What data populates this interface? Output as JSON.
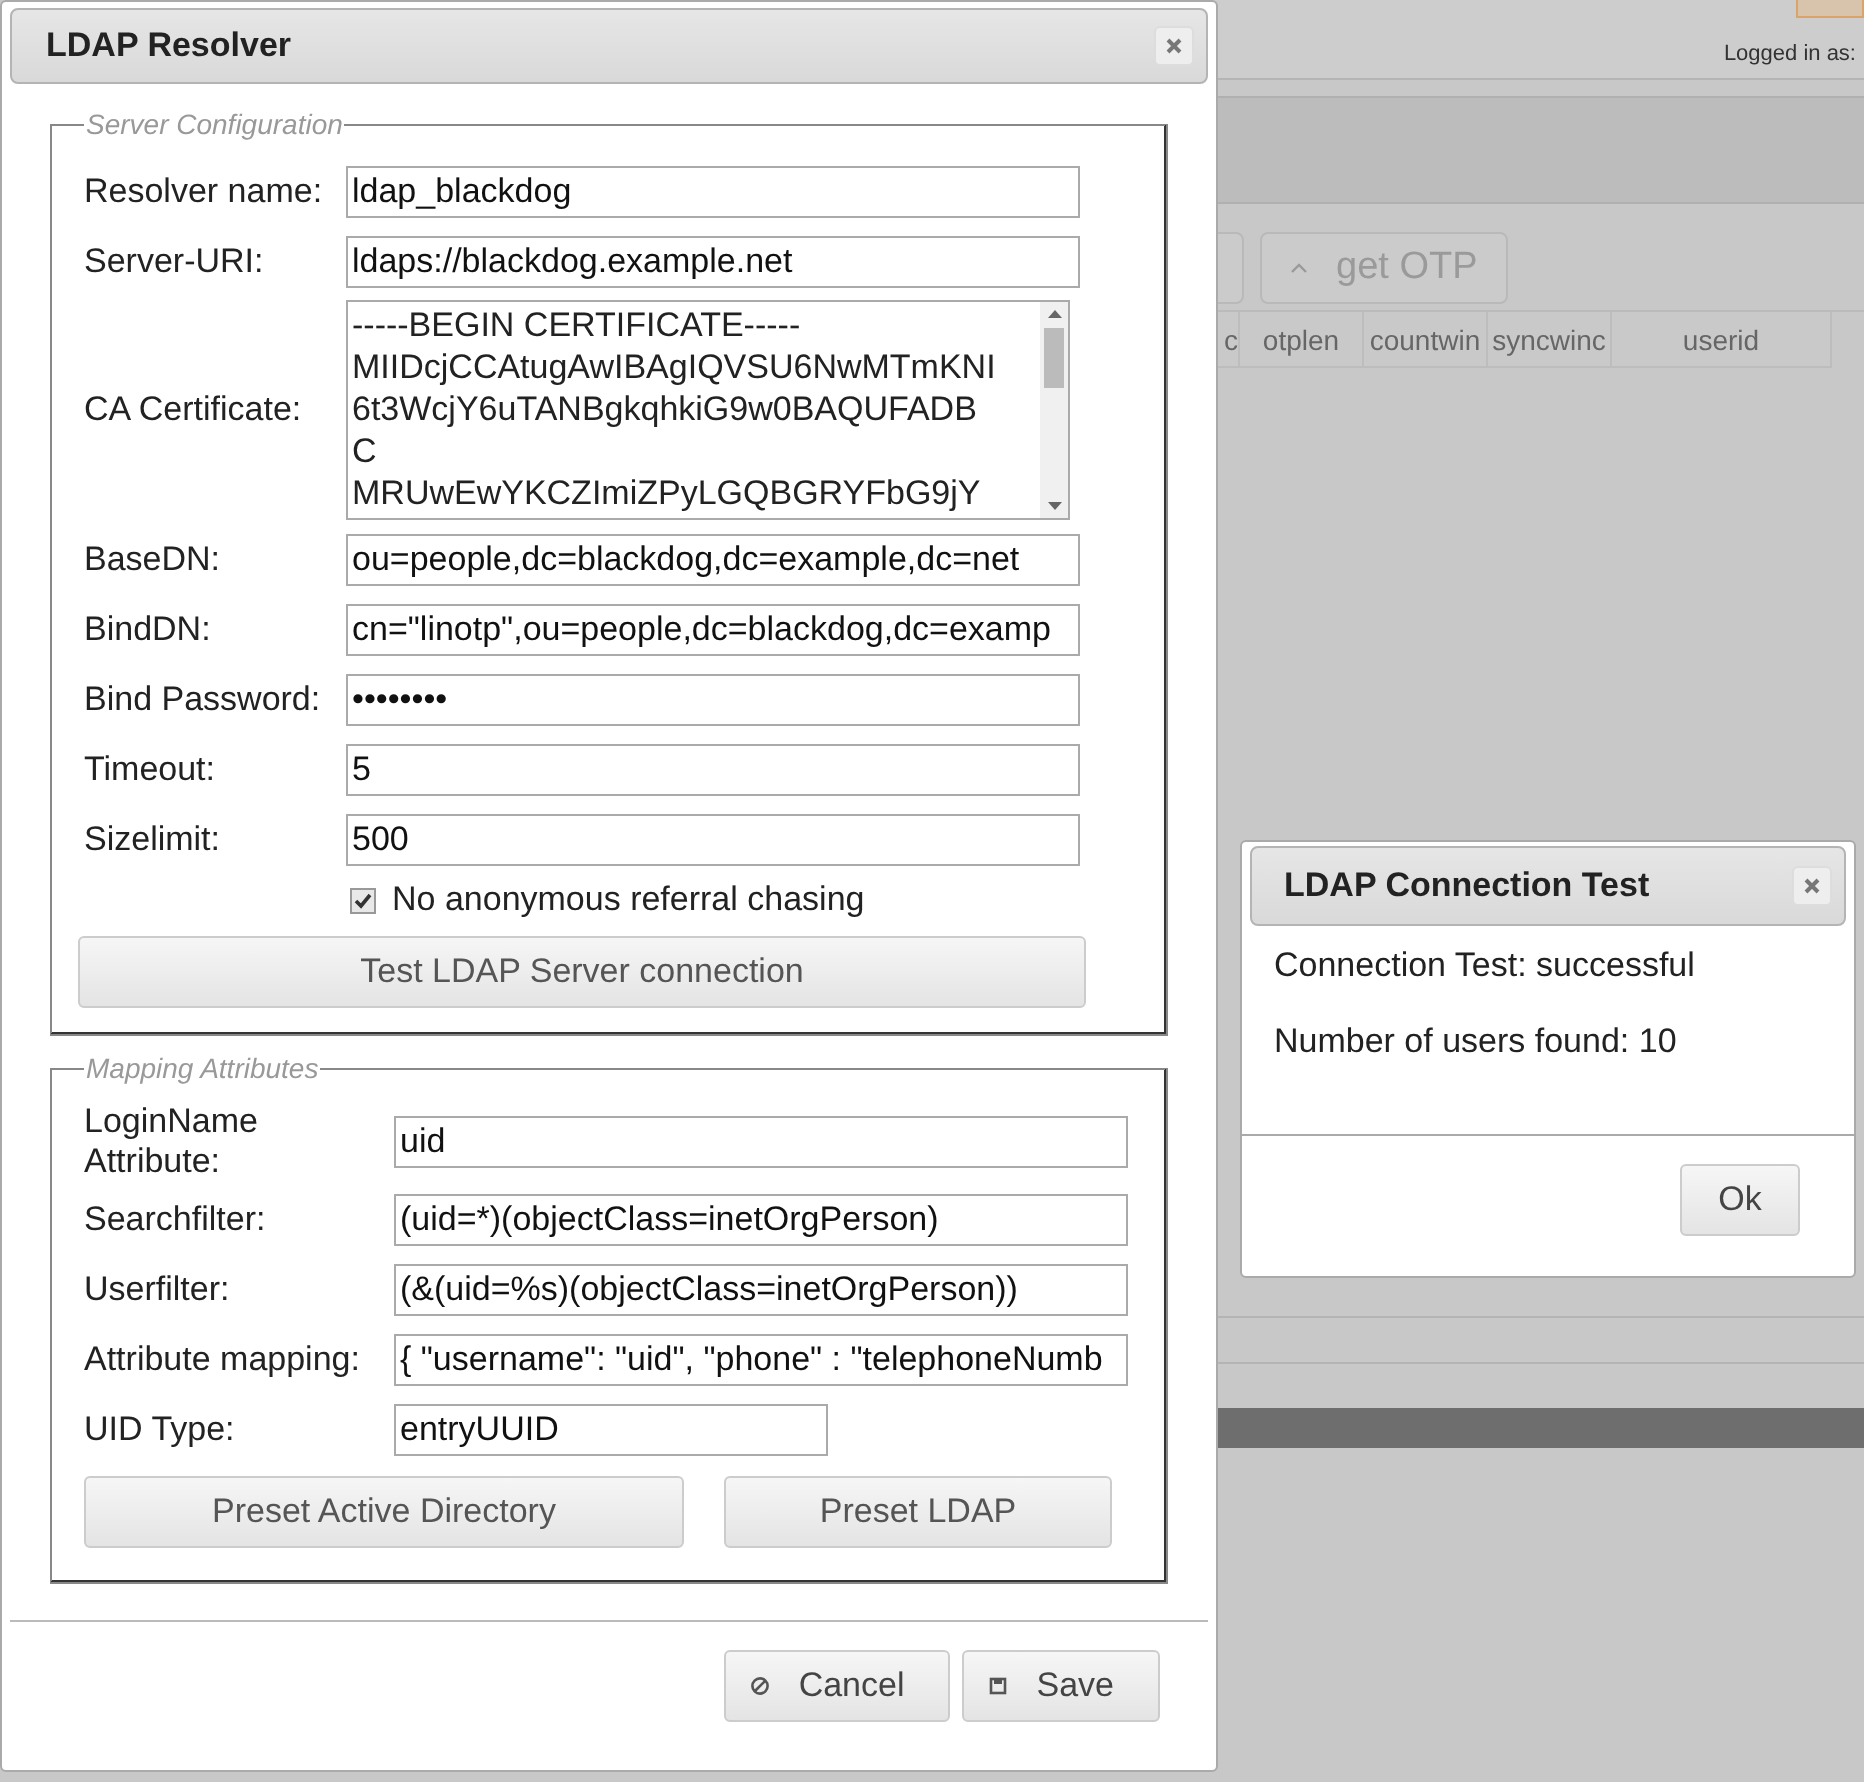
{
  "background": {
    "logged_in_label": "Logged in as:",
    "get_otp_button": "get OTP",
    "columns": [
      "c",
      "otplen",
      "countwin",
      "syncwinc",
      "userid"
    ]
  },
  "resolver_dialog": {
    "title": "LDAP Resolver",
    "server_configuration": {
      "legend": "Server Configuration",
      "fields": [
        {
          "kind": "text",
          "label": "Resolver name:",
          "value": "ldap_blackdog"
        },
        {
          "kind": "text",
          "label": "Server-URI:",
          "value": "ldaps://blackdog.example.net"
        },
        {
          "kind": "textarea",
          "label": "CA Certificate:",
          "lines": [
            "-----BEGIN CERTIFICATE-----",
            "MIIDcjCCAtugAwIBAgIQVSU6NwMTmKNI",
            "6t3WcjY6uTANBgkqhkiG9w0BAQUFADB",
            "C",
            "MRUwEwYKCZImiZPyLGQBGRYFbG9jY"
          ]
        },
        {
          "kind": "text",
          "label": "BaseDN:",
          "value": "ou=people,dc=blackdog,dc=example,dc=net"
        },
        {
          "kind": "text",
          "label": "BindDN:",
          "value": "cn=\"linotp\",ou=people,dc=blackdog,dc=examp"
        },
        {
          "kind": "password",
          "label": "Bind Password:",
          "value": "••••••••"
        },
        {
          "kind": "text",
          "label": "Timeout:",
          "value": "5"
        },
        {
          "kind": "text",
          "label": "Sizelimit:",
          "value": "500"
        }
      ],
      "checkbox": {
        "label": "No anonymous referral chasing",
        "checked": true
      },
      "test_button": "Test LDAP Server connection"
    },
    "mapping_attributes": {
      "legend": "Mapping Attributes",
      "fields": [
        {
          "kind": "text",
          "label": "LoginName Attribute:",
          "value": "uid"
        },
        {
          "kind": "text",
          "label": "Searchfilter:",
          "value": "(uid=*)(objectClass=inetOrgPerson)"
        },
        {
          "kind": "text",
          "label": "Userfilter:",
          "value": "(&(uid=%s)(objectClass=inetOrgPerson))"
        },
        {
          "kind": "text",
          "label": "Attribute mapping:",
          "value": "{ \"username\": \"uid\", \"phone\" : \"telephoneNumb"
        },
        {
          "kind": "short",
          "label": "UID Type:",
          "value": "entryUUID"
        }
      ],
      "preset_buttons": [
        "Preset Active Directory",
        "Preset LDAP"
      ]
    },
    "buttons": [
      "Cancel",
      "Save"
    ]
  },
  "test_dialog": {
    "title": "LDAP Connection Test",
    "lines": [
      "Connection Test: successful",
      "Number of users found: 10"
    ],
    "ok_button": "Ok"
  }
}
